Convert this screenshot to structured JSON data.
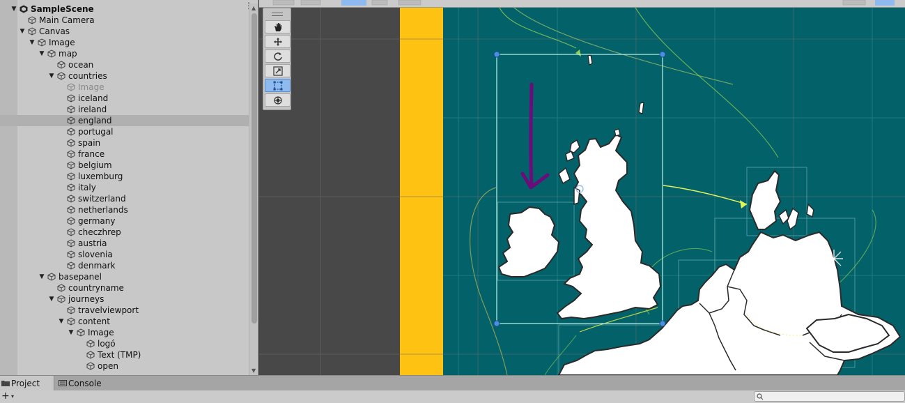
{
  "hierarchy": {
    "scene_menu": "⋮",
    "rows": [
      {
        "label": "SampleScene",
        "depth": 0,
        "expanded": true,
        "scene": true
      },
      {
        "label": "Main Camera",
        "depth": 1,
        "expanded": null
      },
      {
        "label": "Canvas",
        "depth": 1,
        "expanded": true
      },
      {
        "label": "Image",
        "depth": 2,
        "expanded": true
      },
      {
        "label": "map",
        "depth": 3,
        "expanded": true
      },
      {
        "label": "ocean",
        "depth": 4,
        "expanded": null
      },
      {
        "label": "countries",
        "depth": 4,
        "expanded": true
      },
      {
        "label": "Image",
        "depth": 5,
        "expanded": null,
        "dim": true
      },
      {
        "label": "iceland",
        "depth": 5,
        "expanded": null
      },
      {
        "label": "ireland",
        "depth": 5,
        "expanded": null
      },
      {
        "label": "england",
        "depth": 5,
        "expanded": null,
        "selected": true
      },
      {
        "label": "portugal",
        "depth": 5,
        "expanded": null
      },
      {
        "label": "spain",
        "depth": 5,
        "expanded": null
      },
      {
        "label": "france",
        "depth": 5,
        "expanded": null
      },
      {
        "label": "belgium",
        "depth": 5,
        "expanded": null
      },
      {
        "label": "luxemburg",
        "depth": 5,
        "expanded": null
      },
      {
        "label": "italy",
        "depth": 5,
        "expanded": null
      },
      {
        "label": "switzerland",
        "depth": 5,
        "expanded": null
      },
      {
        "label": "netherlands",
        "depth": 5,
        "expanded": null
      },
      {
        "label": "germany",
        "depth": 5,
        "expanded": null
      },
      {
        "label": "checzhrep",
        "depth": 5,
        "expanded": null
      },
      {
        "label": "austria",
        "depth": 5,
        "expanded": null
      },
      {
        "label": "slovenia",
        "depth": 5,
        "expanded": null
      },
      {
        "label": "denmark",
        "depth": 5,
        "expanded": null
      },
      {
        "label": "basepanel",
        "depth": 3,
        "expanded": true
      },
      {
        "label": "countryname",
        "depth": 4,
        "expanded": null
      },
      {
        "label": "journeys",
        "depth": 4,
        "expanded": true
      },
      {
        "label": "travelviewport",
        "depth": 5,
        "expanded": null
      },
      {
        "label": "content",
        "depth": 5,
        "expanded": true
      },
      {
        "label": "Image",
        "depth": 6,
        "expanded": true
      },
      {
        "label": "logó",
        "depth": 7,
        "expanded": null
      },
      {
        "label": "Text (TMP)",
        "depth": 7,
        "expanded": null
      },
      {
        "label": "open",
        "depth": 7,
        "expanded": null
      }
    ]
  },
  "scene_tools": [
    {
      "name": "hand-tool",
      "active": false
    },
    {
      "name": "move-tool",
      "active": false
    },
    {
      "name": "rotate-tool",
      "active": false
    },
    {
      "name": "scale-tool",
      "active": false
    },
    {
      "name": "rect-tool",
      "active": true
    },
    {
      "name": "transform-tool",
      "active": false
    }
  ],
  "bottom_tabs": [
    {
      "label": "Project",
      "active": true
    },
    {
      "label": "Console",
      "active": false
    }
  ],
  "bottom_bar": {
    "add_label": "+",
    "add_dropdown": "▾"
  },
  "colors": {
    "ocean": "#03616a",
    "yellow_strip": "#fec213",
    "dark_panel": "#484848",
    "land": "#ffffff",
    "annotation_arrow": "#6a0c7a",
    "selection": "#9ff0e6"
  }
}
